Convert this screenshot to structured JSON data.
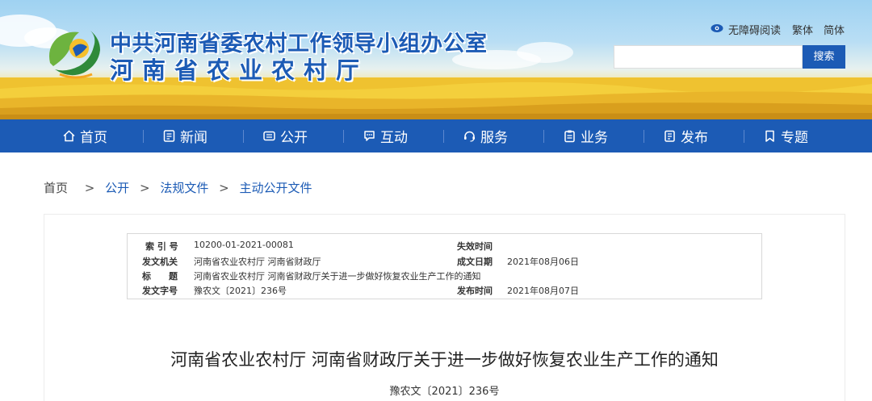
{
  "header": {
    "org_name": "中共河南省委农村工作领导小组办公室",
    "dept_name": "河南省农业农村厅",
    "accessibility_label": "无障碍阅读",
    "traditional_label": "繁体",
    "simplified_label": "简体",
    "search_placeholder": "",
    "search_button_label": "搜索"
  },
  "nav": {
    "items": [
      {
        "label": "首页",
        "icon": "home-icon"
      },
      {
        "label": "新闻",
        "icon": "news-icon"
      },
      {
        "label": "公开",
        "icon": "disclosure-icon"
      },
      {
        "label": "互动",
        "icon": "chat-icon"
      },
      {
        "label": "服务",
        "icon": "service-icon"
      },
      {
        "label": "业务",
        "icon": "clipboard-icon"
      },
      {
        "label": "发布",
        "icon": "publish-icon"
      },
      {
        "label": "专题",
        "icon": "bookmark-icon"
      }
    ]
  },
  "breadcrumb": {
    "home": "首页",
    "separator": ">",
    "items": [
      "公开",
      "法规文件",
      "主动公开文件"
    ]
  },
  "meta": {
    "index_label": "索 引 号",
    "index_value": "10200-01-2021-00081",
    "issuer_label": "发文机关",
    "issuer_value": "河南省农业农村厅 河南省财政厅",
    "title_label": "标　　题",
    "title_value": "河南省农业农村厅 河南省财政厅关于进一步做好恢复农业生产工作的通知",
    "docno_label": "发文字号",
    "docno_value": "豫农文〔2021〕236号",
    "expire_label": "失效时间",
    "expire_value": "",
    "created_label": "成文日期",
    "created_value": "2021年08月06日",
    "published_label": "发布时间",
    "published_value": "2021年08月07日"
  },
  "document": {
    "title": "河南省农业农村厅 河南省财政厅关于进一步做好恢复农业生产工作的通知",
    "number": "豫农文〔2021〕236号"
  },
  "colors": {
    "brand_blue": "#1c5bb5",
    "field_gold": "#f1c53a"
  }
}
